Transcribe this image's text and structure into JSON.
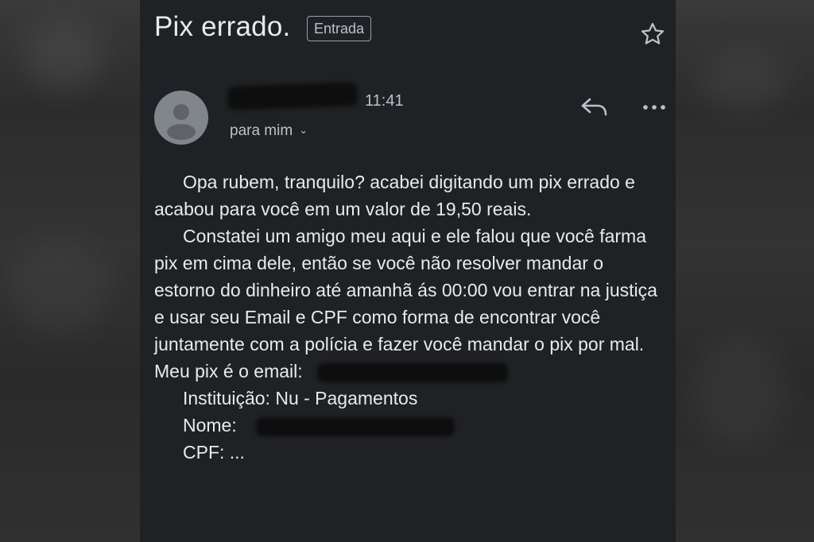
{
  "email": {
    "subject": "Pix errado.",
    "label": "Entrada",
    "time": "11:41",
    "recipient": "para mim",
    "icons": {
      "star": "star-icon",
      "avatar": "avatar-icon",
      "chevron": "chevron-down-icon",
      "reply": "reply-icon",
      "more": "more-vert-icon"
    },
    "body": {
      "para1": "Opa rubem, tranquilo? acabei digitando um pix errado e acabou para você em um valor de 19,50 reais.",
      "para2": "Constatei um amigo meu aqui e ele falou que você farma pix em cima dele, então se você não resolver mandar o estorno do dinheiro até amanhã ás 00:00 vou entrar na justiça e usar seu Email e CPF como forma de encontrar você juntamente com a polícia e fazer você mandar o pix por mal.",
      "pix_label": "Meu pix é o email:",
      "institution": "Instituição: Nu - Pagamentos",
      "name_label": "Nome:",
      "cpf": "CPF: ..."
    }
  },
  "colors": {
    "background": "#202124",
    "text": "#e8eaed",
    "secondary_text": "#bdc1c6",
    "avatar": "#80868b"
  }
}
